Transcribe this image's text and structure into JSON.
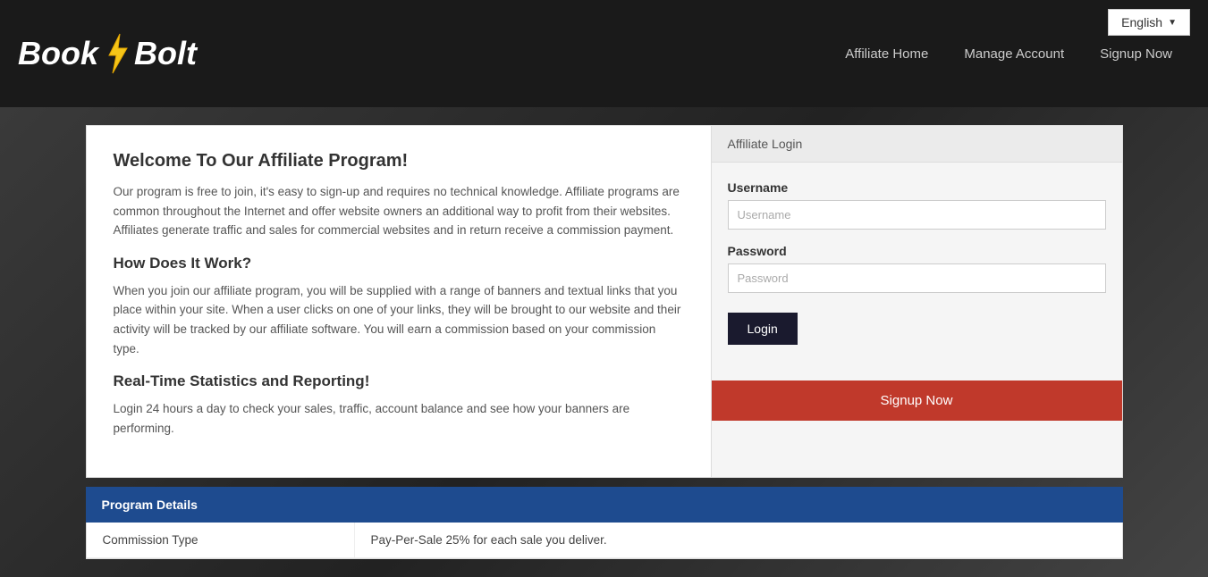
{
  "header": {
    "logo_text_left": "Book",
    "logo_text_right": "Bolt",
    "lang_label": "English",
    "nav": [
      {
        "label": "Affiliate Home",
        "id": "affiliate-home"
      },
      {
        "label": "Manage Account",
        "id": "manage-account"
      },
      {
        "label": "Signup Now",
        "id": "signup-now"
      }
    ]
  },
  "left": {
    "title": "Welcome To Our Affiliate Program!",
    "intro": "Our program is free to join, it's easy to sign-up and requires no technical knowledge. Affiliate programs are common throughout the Internet and offer website owners an additional way to profit from their websites. Affiliates generate traffic and sales for commercial websites and in return receive a commission payment.",
    "how_title": "How Does It Work?",
    "how_text": "When you join our affiliate program, you will be supplied with a range of banners and textual links that you place within your site. When a user clicks on one of your links, they will be brought to our website and their activity will be tracked by our affiliate software. You will earn a commission based on your commission type.",
    "stats_title": "Real-Time Statistics and Reporting!",
    "stats_text": "Login 24 hours a day to check your sales, traffic, account balance and see how your banners are performing."
  },
  "login_panel": {
    "header": "Affiliate Login",
    "username_label": "Username",
    "username_placeholder": "Username",
    "password_label": "Password",
    "password_placeholder": "Password",
    "login_button": "Login",
    "signup_button": "Signup Now"
  },
  "program_details": {
    "section_title": "Program Details",
    "rows": [
      {
        "label": "Commission Type",
        "value": "Pay-Per-Sale 25% for each sale you deliver."
      }
    ]
  }
}
